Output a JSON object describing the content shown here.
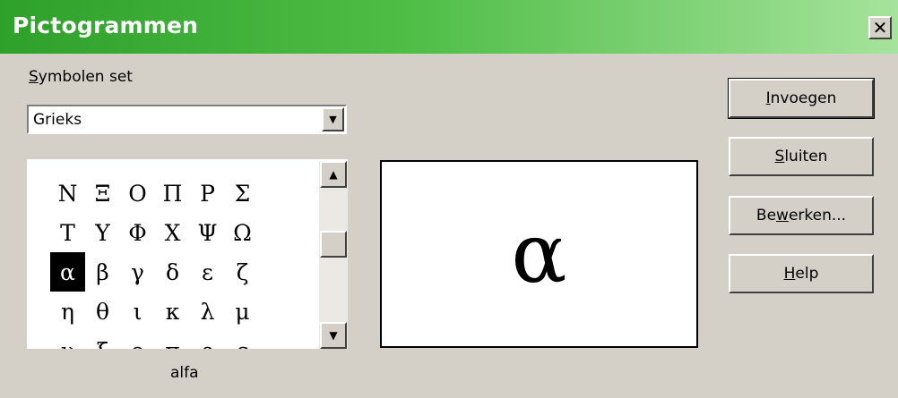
{
  "window": {
    "title": "Pictogrammen",
    "close_glyph": "✕"
  },
  "symbol_set": {
    "label": "Symbolen set",
    "value": "Grieks"
  },
  "grid": {
    "rows": [
      [
        "Ν",
        "Ξ",
        "Ο",
        "Π",
        "Ρ",
        "Σ"
      ],
      [
        "Τ",
        "Υ",
        "Φ",
        "Χ",
        "Ψ",
        "Ω"
      ],
      [
        "α",
        "β",
        "γ",
        "δ",
        "ε",
        "ζ"
      ],
      [
        "η",
        "θ",
        "ι",
        "κ",
        "λ",
        "μ"
      ],
      [
        "ν",
        "ξ",
        "ο",
        "π",
        "ρ",
        "ς"
      ]
    ],
    "selected": "α",
    "selected_name": "alfa"
  },
  "preview": {
    "symbol": "α"
  },
  "buttons": {
    "insert": "Invoegen",
    "close": "Sluiten",
    "edit": "Bewerken...",
    "help": "Help"
  },
  "icons": {
    "dropdown": "chevron-down-icon",
    "scroll_up": "arrow-up-icon",
    "scroll_down": "arrow-down-icon",
    "close": "close-icon"
  }
}
